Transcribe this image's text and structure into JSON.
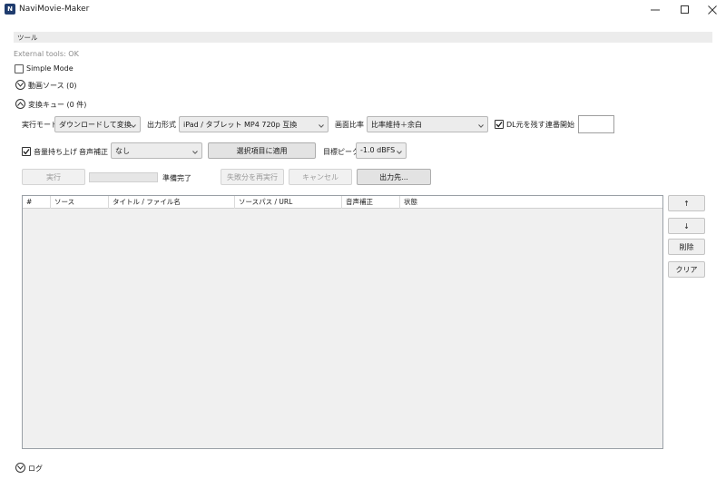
{
  "window": {
    "title": "NaviMovie-Maker",
    "icon_glyph": "N"
  },
  "tools": {
    "label": "ツール",
    "external_status": "External tools: OK"
  },
  "simple_mode": {
    "label": "Simple Mode",
    "checked": false
  },
  "sources_section": {
    "label": "動画ソース (0)"
  },
  "queue_section": {
    "label": "変換キュー (0 件)"
  },
  "options": {
    "run_mode_label": "実行モード",
    "run_mode_value": "ダウンロードして変換",
    "output_format_label": "出力形式",
    "output_format_value": "iPad / タブレット MP4 720p 互換",
    "aspect_label": "画面比率",
    "aspect_value": "比率維持＋余白",
    "keep_dl_label": "DL元を残す",
    "keep_dl_checked": true,
    "serial_start_label": "連番開始",
    "serial_start_value": "",
    "volume_boost_label": "音量持ち上げ",
    "volume_boost_checked": true,
    "audio_correction_label": "音声補正",
    "audio_correction_value": "なし",
    "apply_selected_label": "選択項目に適用",
    "target_peak_label": "目標ピーク",
    "target_peak_value": "-1.0 dBFS"
  },
  "actions": {
    "run_label": "実行",
    "progress_percent": 0,
    "status_text": "準備完了",
    "retry_failed_label": "失敗分を再実行",
    "cancel_label": "キャンセル",
    "output_dest_label": "出力先..."
  },
  "table": {
    "columns": [
      "#",
      "ソース",
      "タイトル / ファイル名",
      "ソースパス / URL",
      "音声補正",
      "状態"
    ],
    "rows": []
  },
  "side_buttons": {
    "up_label": "↑",
    "down_label": "↓",
    "delete_label": "削除",
    "clear_label": "クリア"
  },
  "log_section": {
    "label": "ログ"
  },
  "colors": {
    "accent": "#1f3c6e",
    "disabled_text": "#9a9a9a",
    "panel_bg": "#ececec"
  }
}
